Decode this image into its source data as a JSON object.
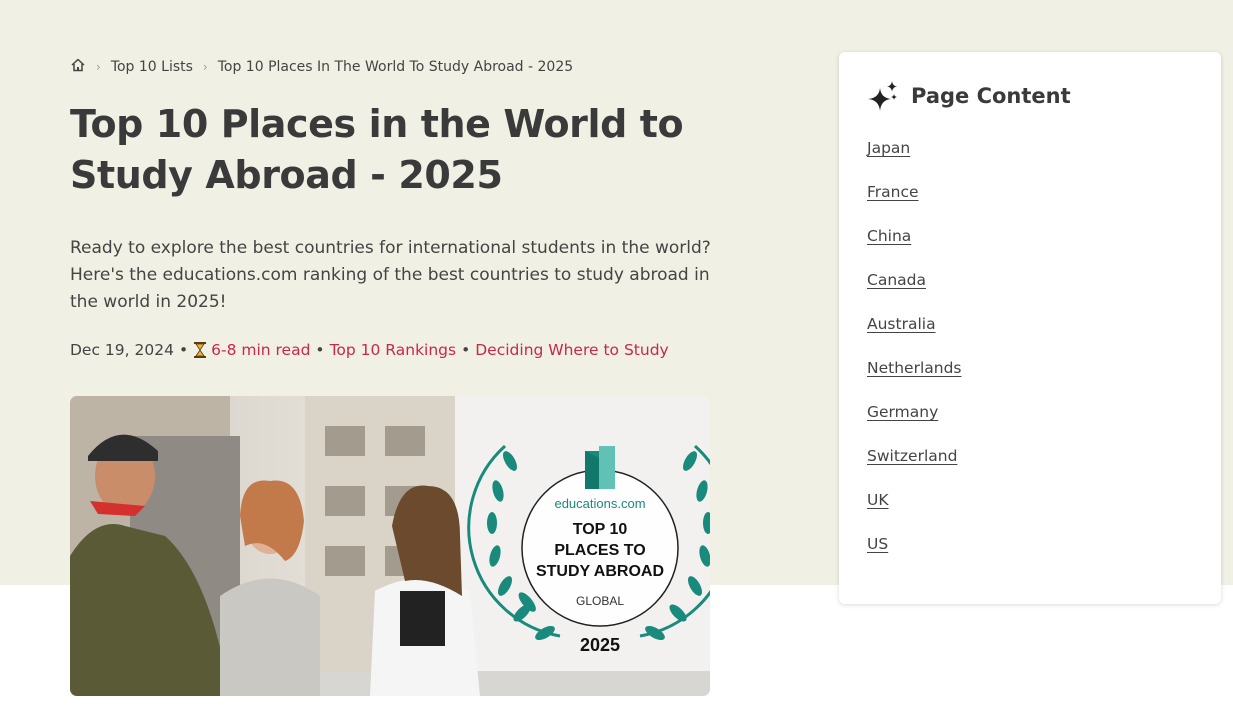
{
  "breadcrumb": {
    "home_icon": "home-icon",
    "items": [
      "Top 10 Lists",
      "Top 10 Places In The World To Study Abroad - 2025"
    ]
  },
  "article": {
    "title": "Top 10 Places in the World to Study Abroad - 2025",
    "intro": "Ready to explore the best countries for international students in the world? Here's the educations.com ranking of the best countries to study abroad in the world in 2025!",
    "date": "Dec 19, 2024",
    "read_time": "6-8 min read",
    "tags": [
      "Top 10 Rankings",
      "Deciding Where to Study"
    ],
    "link_color": "#c8284a"
  },
  "hero_badge": {
    "brand": "educations.com",
    "line1": "TOP 10",
    "line2": "PLACES TO",
    "line3": "STUDY ABROAD",
    "scope": "GLOBAL",
    "year": "2025",
    "accent_color": "#1a8a7c"
  },
  "toc": {
    "icon": "sparkle-icon",
    "title": "Page Content",
    "items": [
      "Japan",
      "France",
      "China",
      "Canada",
      "Australia",
      "Netherlands",
      "Germany",
      "Switzerland",
      "UK",
      "US"
    ]
  },
  "colors": {
    "hero_background": "#f1f0e4",
    "heading": "#3a3a3a",
    "link_accent": "#c8284a"
  }
}
